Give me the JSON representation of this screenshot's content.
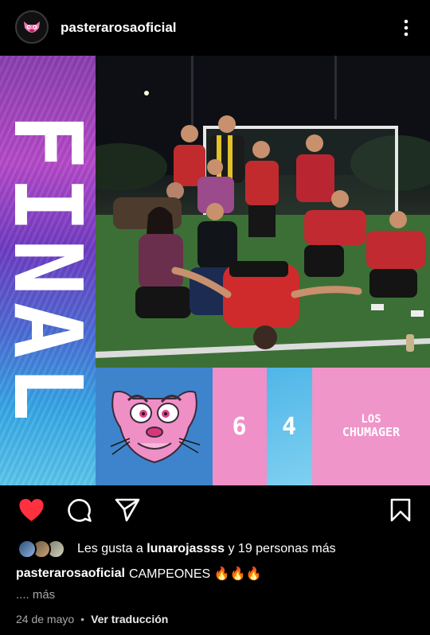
{
  "header": {
    "username": "pasterarosaoficial",
    "avatar_icon": "pink-panther-logo-icon",
    "menu_icon": "more-vertical-icon"
  },
  "post": {
    "banner_text": "FINAL",
    "home_score": "6",
    "away_score": "4",
    "away_team_line1": "LOS",
    "away_team_line2": "CHUMAGER",
    "team_logo_icon": "pink-panther-face-icon",
    "colors": {
      "home_panel": "#3e84cc",
      "score_pink": "#ef90c9",
      "score_blue": "#4fb6e8",
      "away_panel": "#ef95c9"
    }
  },
  "actions": {
    "like_icon": "heart-filled-icon",
    "comment_icon": "comment-icon",
    "share_icon": "send-icon",
    "save_icon": "bookmark-icon",
    "like_color": "#ff3040"
  },
  "likes": {
    "prefix": "Les gusta a",
    "user": "lunarojassss",
    "suffix": "y 19 personas más"
  },
  "caption": {
    "username": "pasterarosaoficial",
    "text": "CAMPEONES 🔥🔥🔥",
    "more": ".... más"
  },
  "meta": {
    "date": "24 de mayo",
    "separator": "•",
    "translate": "Ver traducción"
  }
}
